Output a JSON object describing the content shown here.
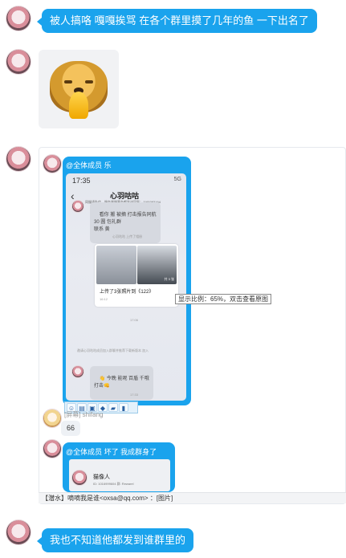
{
  "messages": {
    "m1": "被人搞咯 嘎嘎挨骂 在各个群里摸了几年的鱼 一下出名了",
    "m4": "我也不知道他都发到谁群里的"
  },
  "forward": {
    "caption1": "@全体成员 乐",
    "caption2": "@全体成员 坏了 我成群身了",
    "name_label": "[屏幕] shifang",
    "count": "66",
    "bottom_bar": "【潜水】嘀嘀我是谁<oxsa@qq.com> ：[图片]"
  },
  "phone": {
    "time": "17:35",
    "signal": "5G",
    "back": "‹",
    "title": "心羽咕咕",
    "subtitle": "同服请私信，服务器服事务都发送回复：1165383164",
    "bubble1": "看你 搬 被摘 打击报告同航\n30 圆 包礼群\n联系 黄",
    "notice": "心羽咕咕 上传了相册",
    "card_title": "上传了3张照片到《122》",
    "card_time": "16:12",
    "card_badge": "共 3 张",
    "time2": "17:06",
    "recall": "邀请心羽咕咕成员加入群聊并推荐下载新版本 加入",
    "bubble2": "👋 今晚 能呢 百盾 千哦\n打击👊",
    "time3": "17:33"
  },
  "phone2": {
    "title": "猫像人",
    "subtitle": "ID: 1016999604 群: Rewarel"
  },
  "tooltip": "显示比例：65%，双击查看原图",
  "toolbar_icons": [
    "smile-icon",
    "document-icon",
    "image-icon",
    "gift-icon",
    "folder-icon",
    "bookmark-icon"
  ],
  "colors": {
    "accent": "#1aa3ed",
    "panel_border": "#e6e9ee"
  }
}
